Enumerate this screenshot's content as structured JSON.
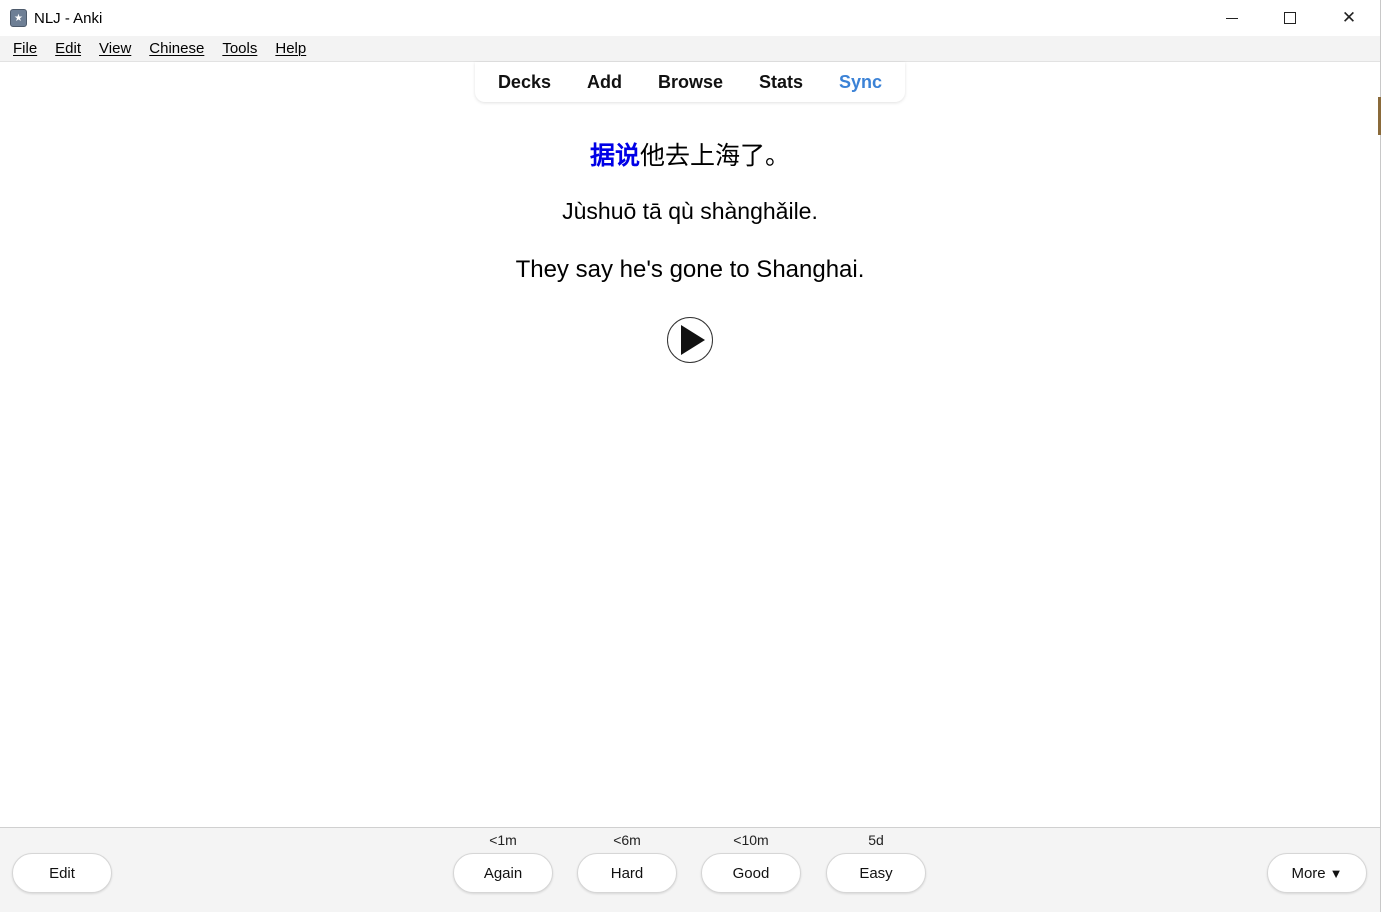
{
  "window": {
    "title": "NLJ - Anki",
    "app_icon": "anki-icon",
    "controls": [
      "minimize-icon",
      "maximize-icon",
      "close-icon"
    ],
    "close_glyph": "✕"
  },
  "menubar": {
    "items": [
      {
        "label": "File"
      },
      {
        "label": "Edit"
      },
      {
        "label": "View"
      },
      {
        "label": "Chinese"
      },
      {
        "label": "Tools"
      },
      {
        "label": "Help"
      }
    ]
  },
  "toolbar": {
    "tabs": [
      {
        "label": "Decks"
      },
      {
        "label": "Add"
      },
      {
        "label": "Browse"
      },
      {
        "label": "Stats"
      },
      {
        "label": "Sync"
      }
    ],
    "sync_color": "#3b82d6"
  },
  "card": {
    "sentence_highlight": "据说",
    "sentence_rest": "他去上海了。",
    "highlight_color": "#0000e6",
    "pinyin": "Jùshuō tā qù shànghǎile.",
    "english": "They say he's gone to Shanghai.",
    "play_icon": "play-icon"
  },
  "bottombar": {
    "edit_label": "Edit",
    "more_label": "More",
    "more_arrow": "▼",
    "answers": [
      {
        "label": "Again",
        "time": "<1m"
      },
      {
        "label": "Hard",
        "time": "<6m"
      },
      {
        "label": "Good",
        "time": "<10m"
      },
      {
        "label": "Easy",
        "time": "5d"
      }
    ]
  }
}
